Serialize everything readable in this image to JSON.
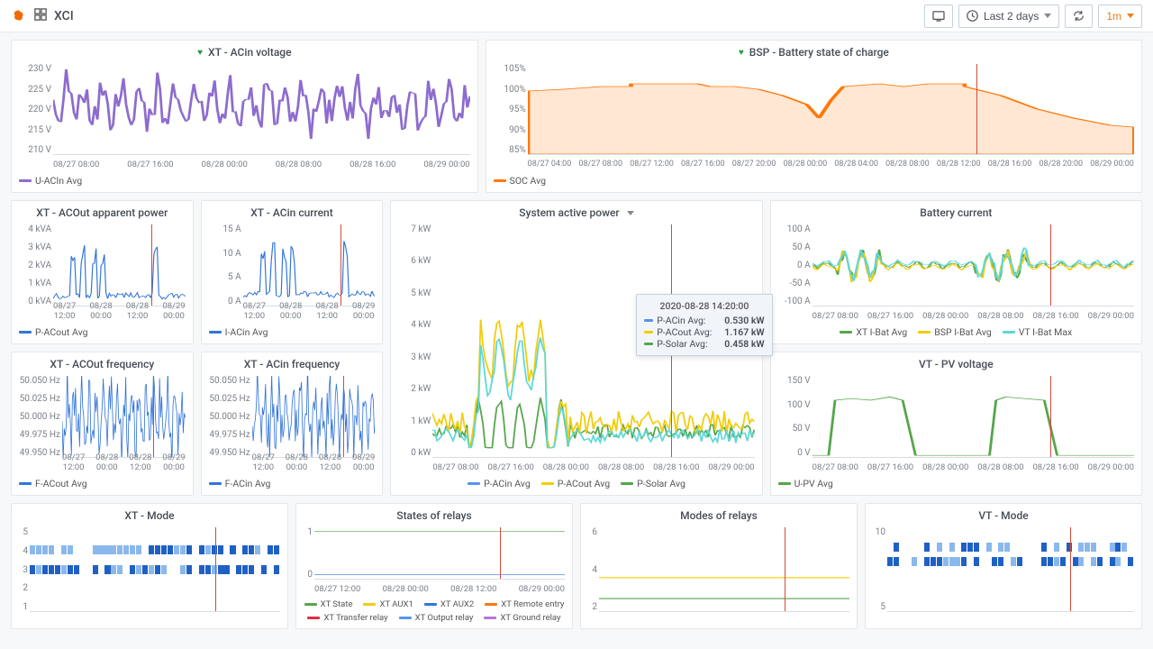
{
  "topbar": {
    "title": "XCI",
    "time_range": "Last 2 days",
    "refresh": "1m"
  },
  "panels": {
    "acin_v": {
      "title": "XT - ACin voltage",
      "legend": "U-ACIn Avg",
      "yticks": [
        "230 V",
        "225 V",
        "220 V",
        "215 V",
        "210 V"
      ],
      "xticks": [
        "08/27 08:00",
        "08/27 16:00",
        "08/28 00:00",
        "08/28 08:00",
        "08/28 16:00",
        "08/29 00:00"
      ]
    },
    "soc": {
      "title": "BSP - Battery state of charge",
      "legend": "SOC Avg",
      "yticks": [
        "105%",
        "100%",
        "95%",
        "90%",
        "85%"
      ],
      "xticks": [
        "08/27 04:00",
        "08/27 08:00",
        "08/27 12:00",
        "08/27 16:00",
        "08/27 20:00",
        "08/28 00:00",
        "08/28 04:00",
        "08/28 08:00",
        "08/28 12:00",
        "08/28 16:00",
        "08/28 20:00",
        "08/29 00:00"
      ]
    },
    "acout_p": {
      "title": "XT - ACOut apparent power",
      "legend": "P-ACout Avg",
      "yticks": [
        "4 kVA",
        "3 kVA",
        "2 kVA",
        "1 kVA",
        "0 kVA"
      ],
      "xticks": [
        "08/27\n12:00",
        "08/28\n00:00",
        "08/28\n12:00",
        "08/29\n00:00"
      ]
    },
    "acin_i": {
      "title": "XT - ACin current",
      "legend": "I-ACin Avg",
      "yticks": [
        "15 A",
        "10 A",
        "5 A",
        "0 A"
      ],
      "xticks": [
        "08/27\n12:00",
        "08/28\n00:00",
        "08/28\n12:00",
        "08/29\n00:00"
      ]
    },
    "sys_p": {
      "title": "System active power",
      "legend": [
        "P-ACin Avg",
        "P-ACout Avg",
        "P-Solar Avg"
      ],
      "yticks": [
        "7 kW",
        "6 kW",
        "5 kW",
        "4 kW",
        "3 kW",
        "2 kW",
        "1 kW",
        "0 kW"
      ],
      "xticks": [
        "08/27 08:00",
        "08/27 16:00",
        "08/28 00:00",
        "08/28 08:00",
        "08/28 16:00",
        "08/29 00:00"
      ],
      "tooltip": {
        "time": "2020-08-28 14:20:00",
        "rows": [
          {
            "label": "P-ACin Avg:",
            "value": "0.530 kW",
            "color": "#5794F2"
          },
          {
            "label": "P-ACout Avg:",
            "value": "1.167 kW",
            "color": "#F2CC0C"
          },
          {
            "label": "P-Solar Avg:",
            "value": "0.458 kW",
            "color": "#56A64B"
          }
        ]
      }
    },
    "bat_i": {
      "title": "Battery current",
      "legend": [
        "XT I-Bat Avg",
        "BSP I-Bat Avg",
        "VT I-Bat Max"
      ],
      "yticks": [
        "100 A",
        "50 A",
        "0 A",
        "-50 A",
        "-100 A"
      ],
      "xticks": [
        "08/27 08:00",
        "08/27 16:00",
        "08/28 00:00",
        "08/28 08:00",
        "08/28 16:00",
        "08/29 00:00"
      ]
    },
    "acout_f": {
      "title": "XT - ACOut frequency",
      "legend": "F-ACout Avg",
      "yticks": [
        "50.050 Hz",
        "50.025 Hz",
        "50.000 Hz",
        "49.975 Hz",
        "49.950 Hz"
      ],
      "xticks": [
        "08/27\n12:00",
        "08/28\n00:00",
        "08/28\n12:00",
        "08/29\n00:00"
      ]
    },
    "acin_f": {
      "title": "XT - ACin frequency",
      "legend": "F-ACin Avg",
      "yticks": [
        "50.050 Hz",
        "50.025 Hz",
        "50.000 Hz",
        "49.975 Hz",
        "49.950 Hz"
      ],
      "xticks": [
        "08/27\n12:00",
        "08/28\n00:00",
        "08/28\n12:00",
        "08/29\n00:00"
      ]
    },
    "pv_v": {
      "title": "VT - PV voltage",
      "legend": "U-PV Avg",
      "yticks": [
        "150 V",
        "100 V",
        "50 V",
        "0 V"
      ],
      "xticks": [
        "08/27 08:00",
        "08/27 16:00",
        "08/28 00:00",
        "08/28 08:00",
        "08/28 16:00",
        "08/29 00:00"
      ]
    },
    "xt_mode": {
      "title": "XT - Mode",
      "yticks": [
        "5",
        "4",
        "3",
        "2",
        "1"
      ],
      "xticks": []
    },
    "relay_state": {
      "title": "States of relays",
      "legend": [
        "XT State",
        "XT AUX1",
        "XT AUX2",
        "XT Remote entry",
        "XT Transfer relay",
        "XT Output relay",
        "XT Ground relay"
      ],
      "yticks": [
        "1",
        "0"
      ],
      "xticks": [
        "08/27 12:00",
        "08/28 00:00",
        "08/28 12:00",
        "08/29 00:00"
      ]
    },
    "relay_mode": {
      "title": "Modes of relays",
      "yticks": [
        "6",
        "4",
        "2"
      ],
      "xticks": []
    },
    "vt_mode": {
      "title": "VT - Mode",
      "yticks": [
        "10",
        "5"
      ],
      "xticks": []
    }
  },
  "colors": {
    "purple": "#8e6cce",
    "orange": "#FF780A",
    "blue": "#3274D9",
    "teal": "#5DD8D8",
    "yellow": "#F2CC0C",
    "green": "#56A64B",
    "lblue": "#5794F2"
  },
  "chart_data": [
    {
      "id": "acin_v",
      "type": "line",
      "ylim": [
        210,
        230
      ],
      "note": "noisy ~218-228V"
    },
    {
      "id": "soc",
      "type": "area",
      "ylim": [
        85,
        105
      ],
      "approx_values_pct": [
        97,
        98,
        100,
        100,
        99,
        97,
        94,
        91,
        96,
        100,
        99,
        100,
        100,
        97,
        94,
        92,
        90,
        89,
        88
      ]
    },
    {
      "id": "acout_p",
      "type": "line",
      "ylim": [
        0,
        4
      ],
      "unit": "kVA"
    },
    {
      "id": "acin_i",
      "type": "line",
      "ylim": [
        0,
        15
      ],
      "unit": "A"
    },
    {
      "id": "sys_p",
      "type": "line",
      "ylim": [
        0,
        7
      ],
      "unit": "kW",
      "series": [
        "P-ACin",
        "P-ACout",
        "P-Solar"
      ]
    },
    {
      "id": "bat_i",
      "type": "line",
      "ylim": [
        -100,
        100
      ],
      "unit": "A"
    },
    {
      "id": "acout_f",
      "type": "line",
      "ylim": [
        49.95,
        50.05
      ],
      "unit": "Hz"
    },
    {
      "id": "acin_f",
      "type": "line",
      "ylim": [
        49.95,
        50.05
      ],
      "unit": "Hz"
    },
    {
      "id": "pv_v",
      "type": "line",
      "ylim": [
        0,
        150
      ],
      "unit": "V"
    },
    {
      "id": "xt_mode",
      "type": "heatmap",
      "ylim": [
        1,
        5
      ]
    },
    {
      "id": "relay_state",
      "type": "line",
      "ylim": [
        0,
        1
      ]
    },
    {
      "id": "relay_mode",
      "type": "line",
      "ylim": [
        0,
        6
      ]
    },
    {
      "id": "vt_mode",
      "type": "heatmap",
      "ylim": [
        5,
        12
      ]
    }
  ]
}
